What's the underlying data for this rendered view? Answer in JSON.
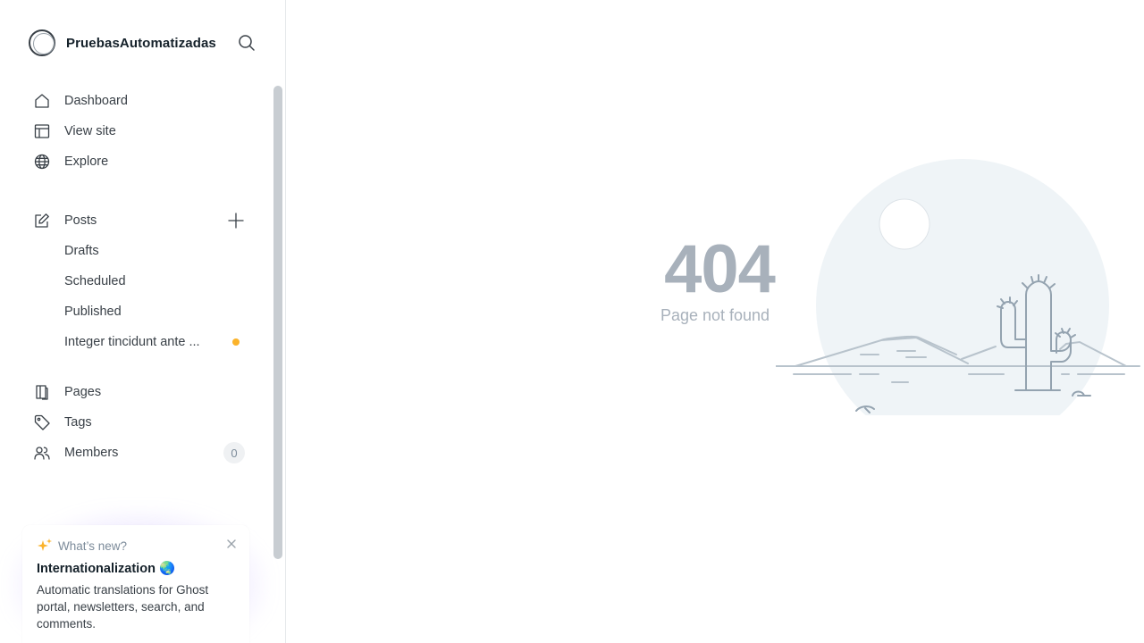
{
  "app": {
    "site_name": "PruebasAutomatizadas"
  },
  "sidebar": {
    "items": [
      {
        "label": "Dashboard",
        "icon": "home-icon"
      },
      {
        "label": "View site",
        "icon": "layout-icon"
      },
      {
        "label": "Explore",
        "icon": "globe-icon"
      },
      {
        "label": "Posts",
        "icon": "pencil-square-icon"
      },
      {
        "label": "Drafts"
      },
      {
        "label": "Scheduled"
      },
      {
        "label": "Published"
      },
      {
        "label": "Integer tincidunt ante ..."
      },
      {
        "label": "Pages",
        "icon": "page-icon"
      },
      {
        "label": "Tags",
        "icon": "tag-icon"
      },
      {
        "label": "Members",
        "icon": "members-icon",
        "count": "0"
      }
    ]
  },
  "whats_new": {
    "heading": "What’s new?",
    "title": "Internationalization 🌏",
    "body": "Automatic translations for Ghost portal, newsletters, search, and comments."
  },
  "error": {
    "code": "404",
    "message": "Page not found"
  },
  "colors": {
    "accent_dot": "#fbb32b",
    "muted_text": "#a8b1bb"
  }
}
